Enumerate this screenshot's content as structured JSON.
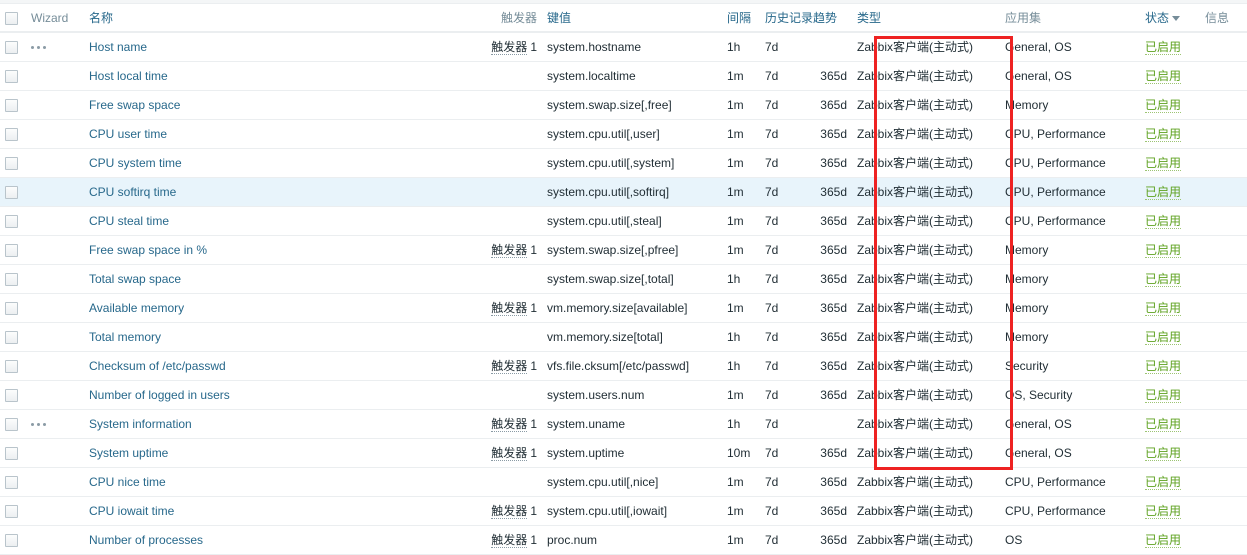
{
  "accent": "#27688b",
  "header_text": "#768d99",
  "status_enabled_color": "#5ea21f",
  "annotation_color": "#ee2222",
  "columns": {
    "checkbox": "",
    "wizard": "Wizard",
    "name": "名称",
    "triggers": "触发器",
    "key": "键值",
    "interval": "间隔",
    "history": "历史记录",
    "trends": "趋势",
    "type": "类型",
    "applications": "应用集",
    "status": "状态",
    "info": "信息"
  },
  "sort": {
    "column": "状态",
    "direction": "desc"
  },
  "labels": {
    "trigger_link": "触发器",
    "status_enabled": "已启用",
    "wizard_dots": "more-options"
  },
  "rows": [
    {
      "wizard": true,
      "name": "Host name",
      "triggers": "1",
      "key": "system.hostname",
      "interval": "1h",
      "history": "7d",
      "trends": "",
      "type": "Zabbix客户端(主动式)",
      "apps": "General, OS",
      "status": "已启用",
      "info": "",
      "selected": false
    },
    {
      "wizard": false,
      "name": "Host local time",
      "triggers": "",
      "key": "system.localtime",
      "interval": "1m",
      "history": "7d",
      "trends": "365d",
      "type": "Zabbix客户端(主动式)",
      "apps": "General, OS",
      "status": "已启用",
      "info": "",
      "selected": false
    },
    {
      "wizard": false,
      "name": "Free swap space",
      "triggers": "",
      "key": "system.swap.size[,free]",
      "interval": "1m",
      "history": "7d",
      "trends": "365d",
      "type": "Zabbix客户端(主动式)",
      "apps": "Memory",
      "status": "已启用",
      "info": "",
      "selected": false
    },
    {
      "wizard": false,
      "name": "CPU user time",
      "triggers": "",
      "key": "system.cpu.util[,user]",
      "interval": "1m",
      "history": "7d",
      "trends": "365d",
      "type": "Zabbix客户端(主动式)",
      "apps": "CPU, Performance",
      "status": "已启用",
      "info": "",
      "selected": false
    },
    {
      "wizard": false,
      "name": "CPU system time",
      "triggers": "",
      "key": "system.cpu.util[,system]",
      "interval": "1m",
      "history": "7d",
      "trends": "365d",
      "type": "Zabbix客户端(主动式)",
      "apps": "CPU, Performance",
      "status": "已启用",
      "info": "",
      "selected": false
    },
    {
      "wizard": false,
      "name": "CPU softirq time",
      "triggers": "",
      "key": "system.cpu.util[,softirq]",
      "interval": "1m",
      "history": "7d",
      "trends": "365d",
      "type": "Zabbix客户端(主动式)",
      "apps": "CPU, Performance",
      "status": "已启用",
      "info": "",
      "selected": true
    },
    {
      "wizard": false,
      "name": "CPU steal time",
      "triggers": "",
      "key": "system.cpu.util[,steal]",
      "interval": "1m",
      "history": "7d",
      "trends": "365d",
      "type": "Zabbix客户端(主动式)",
      "apps": "CPU, Performance",
      "status": "已启用",
      "info": "",
      "selected": false
    },
    {
      "wizard": false,
      "name": "Free swap space in %",
      "triggers": "1",
      "key": "system.swap.size[,pfree]",
      "interval": "1m",
      "history": "7d",
      "trends": "365d",
      "type": "Zabbix客户端(主动式)",
      "apps": "Memory",
      "status": "已启用",
      "info": "",
      "selected": false
    },
    {
      "wizard": false,
      "name": "Total swap space",
      "triggers": "",
      "key": "system.swap.size[,total]",
      "interval": "1h",
      "history": "7d",
      "trends": "365d",
      "type": "Zabbix客户端(主动式)",
      "apps": "Memory",
      "status": "已启用",
      "info": "",
      "selected": false
    },
    {
      "wizard": false,
      "name": "Available memory",
      "triggers": "1",
      "key": "vm.memory.size[available]",
      "interval": "1m",
      "history": "7d",
      "trends": "365d",
      "type": "Zabbix客户端(主动式)",
      "apps": "Memory",
      "status": "已启用",
      "info": "",
      "selected": false
    },
    {
      "wizard": false,
      "name": "Total memory",
      "triggers": "",
      "key": "vm.memory.size[total]",
      "interval": "1h",
      "history": "7d",
      "trends": "365d",
      "type": "Zabbix客户端(主动式)",
      "apps": "Memory",
      "status": "已启用",
      "info": "",
      "selected": false
    },
    {
      "wizard": false,
      "name": "Checksum of /etc/passwd",
      "triggers": "1",
      "key": "vfs.file.cksum[/etc/passwd]",
      "interval": "1h",
      "history": "7d",
      "trends": "365d",
      "type": "Zabbix客户端(主动式)",
      "apps": "Security",
      "status": "已启用",
      "info": "",
      "selected": false
    },
    {
      "wizard": false,
      "name": "Number of logged in users",
      "triggers": "",
      "key": "system.users.num",
      "interval": "1m",
      "history": "7d",
      "trends": "365d",
      "type": "Zabbix客户端(主动式)",
      "apps": "OS, Security",
      "status": "已启用",
      "info": "",
      "selected": false
    },
    {
      "wizard": true,
      "name": "System information",
      "triggers": "1",
      "key": "system.uname",
      "interval": "1h",
      "history": "7d",
      "trends": "",
      "type": "Zabbix客户端(主动式)",
      "apps": "General, OS",
      "status": "已启用",
      "info": "",
      "selected": false
    },
    {
      "wizard": false,
      "name": "System uptime",
      "triggers": "1",
      "key": "system.uptime",
      "interval": "10m",
      "history": "7d",
      "trends": "365d",
      "type": "Zabbix客户端(主动式)",
      "apps": "General, OS",
      "status": "已启用",
      "info": "",
      "selected": false
    },
    {
      "wizard": false,
      "name": "CPU nice time",
      "triggers": "",
      "key": "system.cpu.util[,nice]",
      "interval": "1m",
      "history": "7d",
      "trends": "365d",
      "type": "Zabbix客户端(主动式)",
      "apps": "CPU, Performance",
      "status": "已启用",
      "info": "",
      "selected": false
    },
    {
      "wizard": false,
      "name": "CPU iowait time",
      "triggers": "1",
      "key": "system.cpu.util[,iowait]",
      "interval": "1m",
      "history": "7d",
      "trends": "365d",
      "type": "Zabbix客户端(主动式)",
      "apps": "CPU, Performance",
      "status": "已启用",
      "info": "",
      "selected": false
    },
    {
      "wizard": false,
      "name": "Number of processes",
      "triggers": "1",
      "key": "proc.num",
      "interval": "1m",
      "history": "7d",
      "trends": "365d",
      "type": "Zabbix客户端(主动式)",
      "apps": "OS",
      "status": "已启用",
      "info": "",
      "selected": false
    }
  ]
}
